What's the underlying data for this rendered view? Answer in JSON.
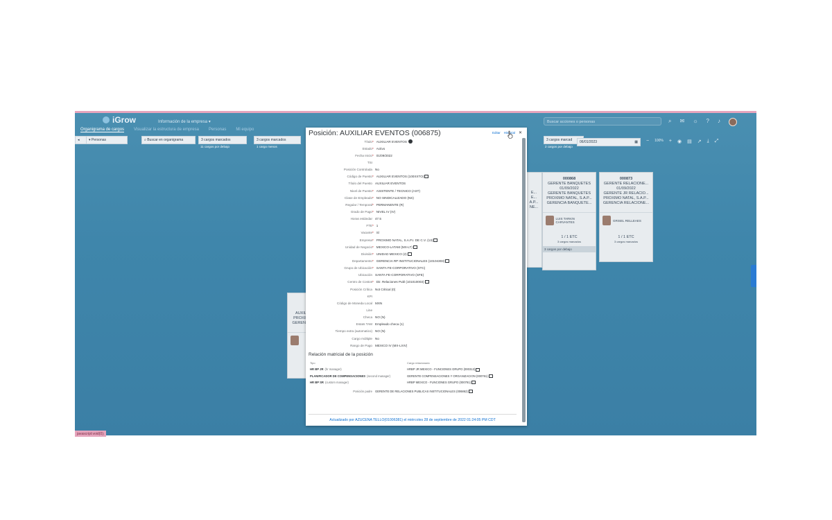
{
  "header": {
    "app_name": "iGrow",
    "menu": "Información de la empresa ▾",
    "search_placeholder": "Buscar acciones o personas"
  },
  "tabs": [
    {
      "label": "Organigrama de cargos",
      "active": true
    },
    {
      "label": "Visualizar la estructura de empresa",
      "active": false
    },
    {
      "label": "Personas",
      "active": false
    },
    {
      "label": "Mi equipo",
      "active": false
    }
  ],
  "toolbar": {
    "filter_label": "Personas",
    "org_search": "Buscar en organigrama",
    "boxes": [
      {
        "label": "3 cargos marcados",
        "sub": "11 cargos por debajo"
      },
      {
        "label": "3 cargos marcados",
        "sub": "1 cargo menos"
      },
      {
        "label": "3 cargos marcad",
        "sub": "2 cargos por debajo"
      }
    ],
    "date": "06/01/2023",
    "zoom": "100%"
  },
  "org_cards": [
    {
      "id": "000868",
      "title": "GERENTE BANQUETES",
      "date": "01/09/2022",
      "line2": "GERENTE BANQUETES",
      "line3": "PROXIMO NATAL, S.A.P...",
      "line4": "GERENCIA BANQUETE...",
      "person": "LUIS TARKIN CARVANTES",
      "fte": "1 / 1 ETC",
      "sub": "3 cargos marcados",
      "foot": "3 cargos por debajo"
    },
    {
      "id": "000873",
      "title": "GERENTE RELACIONE...",
      "date": "01/09/2022",
      "line2": "GERENTE JR RELACIO...",
      "line3": "PROXIMO NATAL, S.A.P...",
      "line4": "GERENCIA RELACIONE...",
      "person": "GRISEL RELLEAES",
      "fte": "1 / 1 ETC",
      "sub": "3 cargos marcados",
      "foot": ""
    }
  ],
  "partial_cards": [
    {
      "id": "AUXIL",
      "line1": "AUXIL",
      "line2": "PROXIM",
      "line3": "GERENCI"
    },
    {
      "lines": [
        "E...",
        "E...",
        "A.P...",
        "NE..."
      ]
    }
  ],
  "bottom_tag": "javascript:void(0);",
  "modal": {
    "title": "Posición: AUXILIAR EVENTOS (006875)",
    "action_edit": "Editar",
    "action_history": "Historial",
    "fields": [
      {
        "label": "Título",
        "required": true,
        "value": "AUXILIAR EVENTOS",
        "icon": "info"
      },
      {
        "label": "Estado",
        "required": true,
        "value": "Activo"
      },
      {
        "label": "Fecha Inicio",
        "required": true,
        "value": "01/09/2022"
      },
      {
        "label": "TSI",
        "required": false,
        "value": ""
      },
      {
        "label": "Posición Controlada",
        "required": false,
        "value": "No"
      },
      {
        "label": "Código de Puesto",
        "required": true,
        "value": "AUXILIAR EVENTOS (100XXTO)",
        "icon": "link"
      },
      {
        "label": "Título del Puesto",
        "required": false,
        "value": "AUXILIAR EVENTOS"
      },
      {
        "label": "Nivel de Puesto",
        "required": true,
        "value": "ASISTENTE / TECNICO (AST)"
      },
      {
        "label": "Clase de Empleado",
        "required": true,
        "value": "NO SINDICALIZADO (NS)"
      },
      {
        "label": "Regular / Temporal",
        "required": true,
        "value": "PERMANENTE (R)"
      },
      {
        "label": "Grado de Pago",
        "required": true,
        "value": "NIVEL IV (IV)"
      },
      {
        "label": "Horas estándar",
        "required": false,
        "value": "47.5"
      },
      {
        "label": "FTE",
        "required": true,
        "value": "1"
      },
      {
        "label": "Vacante",
        "required": true,
        "value": "Sí"
      },
      {
        "label": "Empresa",
        "required": true,
        "value": "PROXIMO NATAL, S.A.P.I. DE C.V. (13)",
        "icon": "link"
      },
      {
        "label": "Unidad de Negocio",
        "required": true,
        "value": "MEXICO-LATAM (MX-LT)",
        "icon": "link"
      },
      {
        "label": "División",
        "required": true,
        "value": "UNIDAD MEXICO (2)",
        "icon": "link"
      },
      {
        "label": "Departamento",
        "required": true,
        "value": "GERENCIA RP INSTITUCIONALES (10104303)",
        "icon": "link"
      },
      {
        "label": "Grupo de Ubicación",
        "required": true,
        "value": "SANTA FE-CORPORATIVO (STC)"
      },
      {
        "label": "Ubicación",
        "required": false,
        "value": "SANTA FE-CORPORATIVO (SFE)"
      },
      {
        "label": "Centro de Costos",
        "required": true,
        "value": "Dir. Relaciones Publ (101010003)",
        "icon": "link"
      },
      {
        "label": "Posición Crítica",
        "required": false,
        "value": "Not Critical (0)"
      },
      {
        "label": "KPI",
        "required": false,
        "value": ""
      },
      {
        "label": "Código de Moneda Local",
        "required": false,
        "value": "MXN"
      },
      {
        "label": "Line",
        "required": false,
        "value": ""
      },
      {
        "label": "Checa",
        "required": false,
        "value": "NO (N)"
      },
      {
        "label": "Estats TAM",
        "required": false,
        "value": "Empleado checa (1)"
      },
      {
        "label": "Tiempo extra (automatico)",
        "required": false,
        "value": "NO (N)"
      },
      {
        "label": "Cargo múltiple",
        "required": false,
        "value": "No"
      },
      {
        "label": "Rango de Pago",
        "required": false,
        "value": "MEXICO IV (MX-LXIV)"
      }
    ],
    "matrix_title": "Relación matricial de la posición",
    "matrix_headers": {
      "type": "Tipo",
      "related": "Cargo relacionado"
    },
    "matrix_rows": [
      {
        "type": "HR BP JR",
        "type_note": "(hr manager)",
        "related": "HRBP JR MEXICO - FUNCIONES GRUPO (000313)"
      },
      {
        "type": "PLANIFICADOR DE COMPENSACIONES",
        "type_note": "(second manager)",
        "related": "GERENTE COMPENSACIONES Y ORGANIZACION (000761)"
      },
      {
        "type": "HR BP SR",
        "type_note": "(custom manager)",
        "related": "HRBP MEXICO - FUNCIONES GRUPO (000781)"
      }
    ],
    "parent_label": "Posición padre",
    "parent_value": "GERENTE DE RELACIONES PUBLICAS INSTITUCIONALES (006862)",
    "footer": "Actualizado por AZUCENA TELLO(01006381) el miércoles 28 de septiembre de 2022 01:24:05 PM CDT"
  }
}
